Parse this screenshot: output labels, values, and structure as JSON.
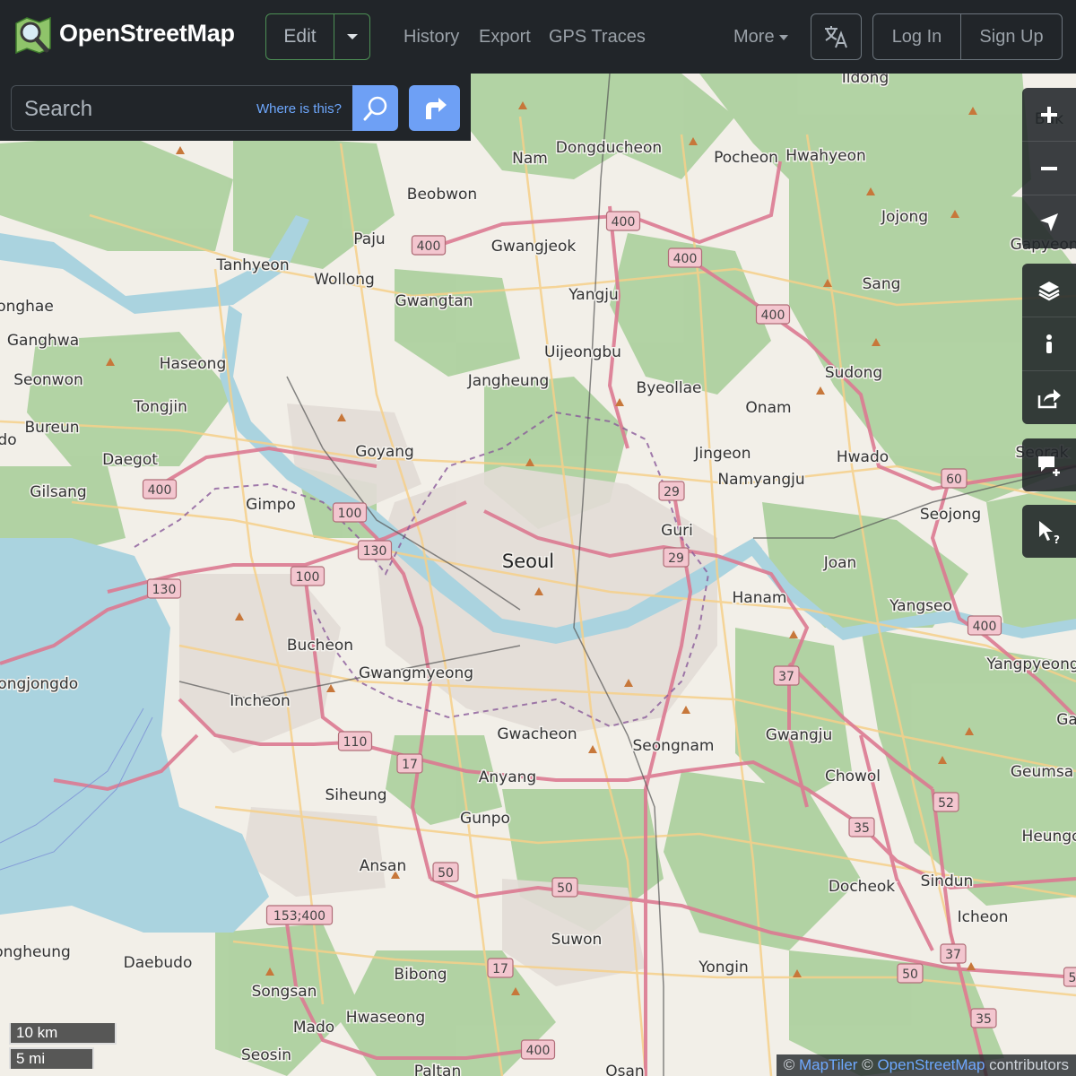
{
  "header": {
    "brand": "OpenStreetMap",
    "edit_label": "Edit",
    "nav": [
      "History",
      "Export",
      "GPS Traces"
    ],
    "more_label": "More",
    "login_label": "Log In",
    "signup_label": "Sign Up"
  },
  "search": {
    "placeholder": "Search",
    "where_label": "Where is this?"
  },
  "controls": {
    "icons": [
      "zoom-in-icon",
      "zoom-out-icon",
      "locate-icon",
      "layers-icon",
      "info-icon",
      "share-icon",
      "add-note-icon",
      "query-icon"
    ]
  },
  "scale": {
    "km": "10 km",
    "mi": "5 mi"
  },
  "attribution": {
    "prefix": "© ",
    "maptiler": "MapTiler",
    "mid": " © ",
    "osm": "OpenStreetMap",
    "suffix": " contributors"
  },
  "map": {
    "places": [
      {
        "n": "Seoul",
        "big": true
      },
      {
        "n": "Dongducheon"
      },
      {
        "n": "Pocheon"
      },
      {
        "n": "Hwahyeon"
      },
      {
        "n": "Ildong"
      },
      {
        "n": "Nam"
      },
      {
        "n": "Beobwon"
      },
      {
        "n": "Paju"
      },
      {
        "n": "Gwangjeok"
      },
      {
        "n": "Jojong"
      },
      {
        "n": "Tanhyeon"
      },
      {
        "n": "Wollong"
      },
      {
        "n": "Gwangtan"
      },
      {
        "n": "Yangju"
      },
      {
        "n": "Sang"
      },
      {
        "n": "Gapyeong"
      },
      {
        "n": "onghae"
      },
      {
        "n": "Ganghwa"
      },
      {
        "n": "Haseong"
      },
      {
        "n": "Uijeongbu"
      },
      {
        "n": "Seonwon"
      },
      {
        "n": "Jangheung"
      },
      {
        "n": "Byeollae"
      },
      {
        "n": "Sudong"
      },
      {
        "n": "Tongjin"
      },
      {
        "n": "Onam"
      },
      {
        "n": "Bureun"
      },
      {
        "n": "Goyang"
      },
      {
        "n": "Daegot"
      },
      {
        "n": "Jingeon"
      },
      {
        "n": "Hwado"
      },
      {
        "n": "Seorak"
      },
      {
        "n": "Namyangju"
      },
      {
        "n": "Gilsang"
      },
      {
        "n": "Gimpo"
      },
      {
        "n": "Seojong"
      },
      {
        "n": "Guri"
      },
      {
        "n": "Joan"
      },
      {
        "n": "Hanam"
      },
      {
        "n": "Yangseo"
      },
      {
        "n": "Bucheon"
      },
      {
        "n": "Yangpyeong"
      },
      {
        "n": "Gwangmyeong"
      },
      {
        "n": "eongjongdo"
      },
      {
        "n": "Incheon"
      },
      {
        "n": "Gwacheon"
      },
      {
        "n": "Seongnam"
      },
      {
        "n": "Gwangju"
      },
      {
        "n": "Anyang"
      },
      {
        "n": "Chowol"
      },
      {
        "n": "Siheung"
      },
      {
        "n": "Geumsa"
      },
      {
        "n": "Gunpo"
      },
      {
        "n": "Heungc"
      },
      {
        "n": "Ansan"
      },
      {
        "n": "Docheok"
      },
      {
        "n": "Sindun"
      },
      {
        "n": "Icheon"
      },
      {
        "n": "Suwon"
      },
      {
        "n": "ongheung"
      },
      {
        "n": "Daebudo"
      },
      {
        "n": "Yongin"
      },
      {
        "n": "Bibong"
      },
      {
        "n": "Songsan"
      },
      {
        "n": "Hwaseong"
      },
      {
        "n": "Mado"
      },
      {
        "n": "Seosin"
      },
      {
        "n": "Paltan"
      },
      {
        "n": "Osan"
      },
      {
        "n": "Buk"
      },
      {
        "n": "Ga"
      },
      {
        "n": "do"
      }
    ],
    "shields": [
      "400",
      "400",
      "400",
      "400",
      "400",
      "400",
      "60",
      "29",
      "29",
      "100",
      "130",
      "100",
      "130",
      "400",
      "37",
      "110",
      "17",
      "52",
      "35",
      "50",
      "50",
      "153;400",
      "17",
      "37",
      "50",
      "35",
      "400",
      "5"
    ]
  }
}
